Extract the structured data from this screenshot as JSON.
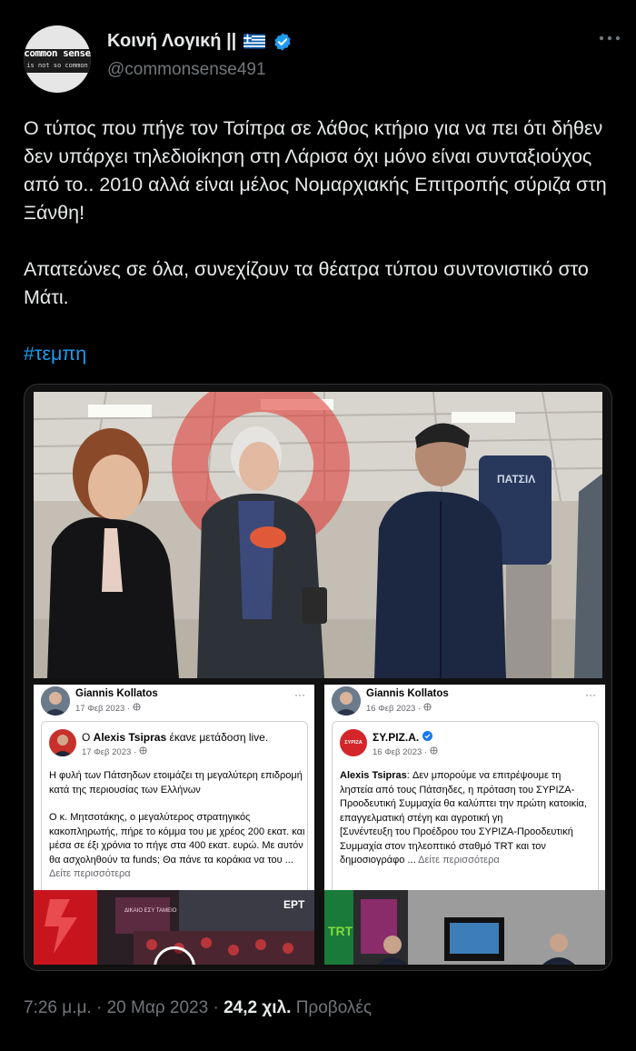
{
  "account": {
    "display_name": "Κοινή Λογική ||",
    "handle": "@commonsense491",
    "avatar_text_1": "common sense",
    "avatar_text_2": "is not so common"
  },
  "tweet": {
    "paragraph_1": "Ο τύπος που πήγε τον Τσίπρα σε λάθος κτήριο για να πει ότι δήθεν δεν υπάρχει τηλεδιοίκηση στη Λάρισα όχι μόνο είναι συνταξιούχος από το.. 2010 αλλά είναι μέλος Νομαρχιακής Επιτροπής σύριζα στη Ξάνθη!",
    "paragraph_2": "Απατεώνες σε όλα, συνεχίζουν τα θέατρα τύπου συντονιστικό στο Μάτι.",
    "hashtag": "#τεμπη"
  },
  "photo": {
    "jacket_text": "ΠΑΤΣΙΛ"
  },
  "fb_left": {
    "author": "Giannis Kollatos",
    "date": "17 Φεβ 2023 · ",
    "dots": "···",
    "shared_author": "Alexis Tsipras",
    "shared_action": " έκανε μετάδοση live.",
    "shared_prefix": "Ο ",
    "shared_date": "17 Φεβ 2023 · ",
    "body_1": "Η φυλή των Πάτσηδων ετοιμάζει τη μεγαλύτερη επιδρομή κατά της περιουσίας των Ελλήνων",
    "body_2": "Ο κ. Μητσοτάκης, ο μεγαλύτερος στρατηγικός κακοπληρωτής, πήρε το κόμμα του με χρέος 200 εκατ. και μέσα σε έξι χρόνια το πήγε στα 400 εκατ. ευρώ. Με αυτόν θα ασχοληθούν τα funds; Θα πάνε τα κοράκια να του ...",
    "see_more": " Δείτε περισσότερα",
    "video_label": "ΕΡΤ",
    "banner_text": "ΔΙΚΑΙΟ ΕΣΥ ΤΑΜΕΙΟ"
  },
  "fb_right": {
    "author": "Giannis Kollatos",
    "date": "16 Φεβ 2023 · ",
    "dots": "···",
    "shared_author": "ΣΥ.ΡΙΖ.Α.",
    "shared_date": "16 Φεβ 2023 · ",
    "logo_text": "ΣΥΡΙΖΑ",
    "body_lead": "Alexis Tsipras",
    "body_1": ": Δεν μπορούμε να επιτρέψουμε τη ληστεία από τους Πάτσηδες, η πρόταση του ΣΥΡΙΖΑ-Προοδευτική Συμμαχία θα καλύπτει την πρώτη κατοικία, επαγγελματική στέγη και αγροτική γη",
    "body_2": "[Συνέντευξη του Προέδρου του ΣΥΡΙΖΑ-Προοδευτική Συμμαχία στον τηλεοπτικό σταθμό TRT και τον δημοσιογράφο ...",
    "see_more": " Δείτε περισσότερα",
    "studio_logo": "TRT"
  },
  "footer": {
    "time": "7:26 μ.μ.",
    "separator": " · ",
    "date": "20 Μαρ 2023",
    "views_count": "24,2 χιλ.",
    "views_label": " Προβολές"
  },
  "colors": {
    "background": "#000000",
    "text": "#e7e9ea",
    "muted": "#71767b",
    "link": "#1d9bf0",
    "verified": "#1d9bf0",
    "syriza_red": "#d4252a"
  },
  "icons": [
    "verified-badge-icon",
    "greek-flag-icon",
    "more-options-icon",
    "play-icon"
  ]
}
